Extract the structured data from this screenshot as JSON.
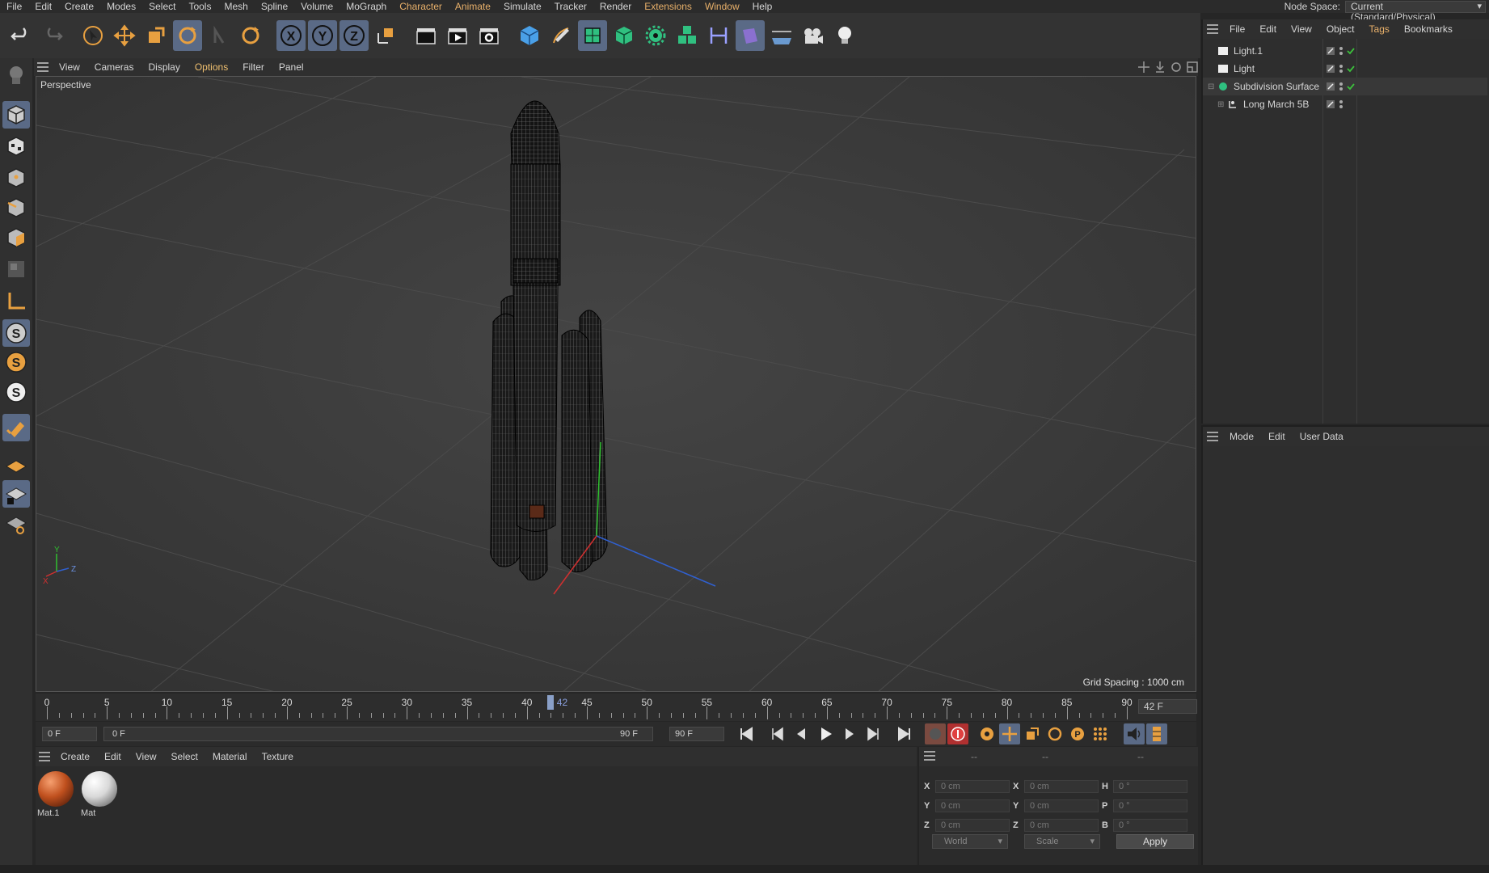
{
  "menubar": {
    "items": [
      "File",
      "Edit",
      "Create",
      "Modes",
      "Select",
      "Tools",
      "Mesh",
      "Spline",
      "Volume",
      "MoGraph",
      "Character",
      "Animate",
      "Simulate",
      "Tracker",
      "Render",
      "Extensions",
      "Window",
      "Help"
    ],
    "node_space_label": "Node Space:",
    "node_space_value": "Current (Standard/Physical)"
  },
  "viewport": {
    "menu": [
      "View",
      "Cameras",
      "Display",
      "Options",
      "Filter",
      "Panel"
    ],
    "camera_label": "Perspective",
    "grid_spacing": "Grid Spacing : 1000 cm",
    "axis_labels": [
      "Y",
      "X",
      "Z"
    ]
  },
  "timeline": {
    "ticks": [
      "0",
      "5",
      "10",
      "15",
      "20",
      "25",
      "30",
      "35",
      "40",
      "45",
      "50",
      "55",
      "60",
      "65",
      "70",
      "75",
      "80",
      "85",
      "90"
    ],
    "current_frame": "42",
    "frame_field": "42 F"
  },
  "time_controls": {
    "start_field": "0 F",
    "range_start": "0 F",
    "range_end": "90 F",
    "end_field": "90 F"
  },
  "material_manager": {
    "menu": [
      "Create",
      "Edit",
      "View",
      "Select",
      "Material",
      "Texture"
    ],
    "materials": [
      {
        "name": "Mat.1",
        "color": "#c0501e"
      },
      {
        "name": "Mat",
        "color": "#d8d8d8"
      }
    ]
  },
  "coordinates": {
    "headers": [
      "--",
      "--",
      "--"
    ],
    "rows": [
      {
        "a": "X",
        "a_val": "0 cm",
        "b": "X",
        "b_val": "0 cm",
        "c": "H",
        "c_val": "0 °"
      },
      {
        "a": "Y",
        "a_val": "0 cm",
        "b": "Y",
        "b_val": "0 cm",
        "c": "P",
        "c_val": "0 °"
      },
      {
        "a": "Z",
        "a_val": "0 cm",
        "b": "Z",
        "b_val": "0 cm",
        "c": "B",
        "c_val": "0 °"
      }
    ],
    "space_dropdown": "World",
    "mode_dropdown": "Scale",
    "apply_label": "Apply"
  },
  "object_manager": {
    "menu": [
      "File",
      "Edit",
      "View",
      "Object",
      "Tags",
      "Bookmarks"
    ],
    "objects": [
      {
        "name": "Light.1",
        "icon": "light-icon"
      },
      {
        "name": "Light",
        "icon": "light-icon"
      },
      {
        "name": "Subdivision Surface",
        "icon": "subdivision-icon"
      },
      {
        "name": "Long March 5B",
        "icon": "null-object-icon"
      }
    ]
  },
  "attribute_manager": {
    "menu": [
      "Mode",
      "Edit",
      "User Data"
    ]
  },
  "colors": {
    "accent": "#e8b06a",
    "active_tool": "#5a6a86",
    "x_axis": "#d03030",
    "y_axis": "#30c030",
    "z_axis": "#3060d0"
  }
}
